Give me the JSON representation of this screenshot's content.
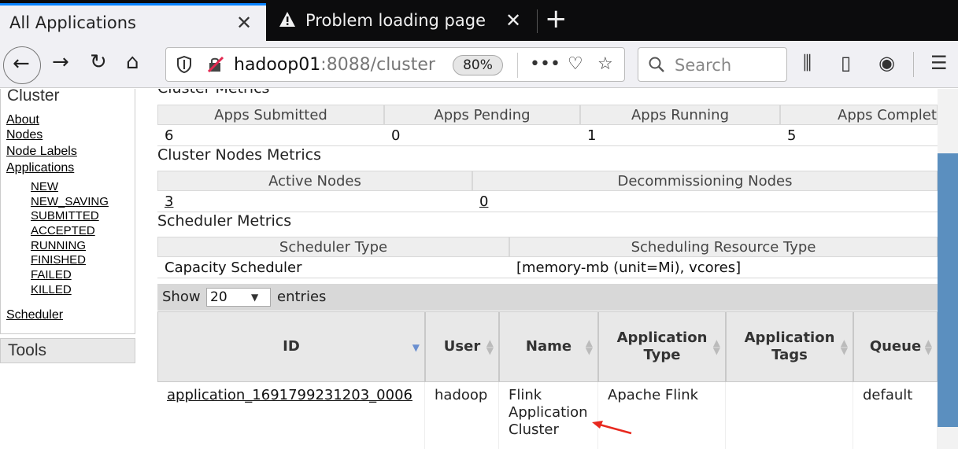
{
  "browser": {
    "tabs": [
      {
        "title": "All Applications",
        "active": true
      },
      {
        "title": "Problem loading page",
        "active": false,
        "icon": "warning-icon"
      }
    ],
    "close_glyph": "✕",
    "new_tab_glyph": "+",
    "url_host": "hadoop01",
    "url_path": ":8088/cluster",
    "zoom": "80%",
    "search_placeholder": "Search",
    "accent_color": "#0a84ff"
  },
  "sidebar": {
    "title": "Cluster",
    "links": [
      "About",
      "Nodes",
      "Node Labels",
      "Applications"
    ],
    "app_states": [
      "NEW",
      "NEW_SAVING",
      "SUBMITTED",
      "ACCEPTED",
      "RUNNING",
      "FINISHED",
      "FAILED",
      "KILLED"
    ],
    "scheduler": "Scheduler",
    "tools": "Tools"
  },
  "cluster_metrics": {
    "title": "Cluster Metrics",
    "headers": [
      "Apps Submitted",
      "Apps Pending",
      "Apps Running",
      "Apps Complet"
    ],
    "values": [
      "6",
      "0",
      "1",
      "5"
    ]
  },
  "node_metrics": {
    "title": "Cluster Nodes Metrics",
    "headers": [
      "Active Nodes",
      "Decommissioning Nodes"
    ],
    "values": [
      "3",
      "0"
    ]
  },
  "scheduler_metrics": {
    "title": "Scheduler Metrics",
    "headers": [
      "Scheduler Type",
      "Scheduling Resource Type"
    ],
    "values": [
      "Capacity Scheduler",
      "[memory-mb (unit=Mi), vcores]"
    ]
  },
  "apps_table": {
    "show_label": "Show",
    "page_size": "20",
    "entries_label": "entries",
    "columns": [
      "ID",
      "User",
      "Name",
      "Application Type",
      "Application Tags",
      "Queue"
    ],
    "rows": [
      {
        "id": "application_1691799231203_0006",
        "user": "hadoop",
        "name": "Flink Application Cluster",
        "type": "Apache Flink",
        "tags": "",
        "queue": "default"
      }
    ]
  }
}
